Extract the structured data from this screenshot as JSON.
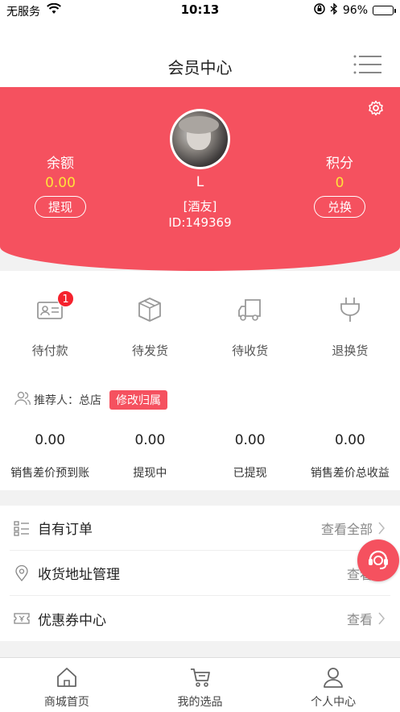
{
  "status_bar": {
    "carrier": "无服务",
    "time": "10:13",
    "battery": "96%"
  },
  "nav": {
    "title": "会员中心"
  },
  "profile": {
    "balance_label": "余额",
    "balance_value": "0.00",
    "withdraw_label": "提现",
    "points_label": "积分",
    "points_value": "0",
    "exchange_label": "兑换",
    "name": "L",
    "level": "[酒友]",
    "id": "ID:149369"
  },
  "orders": [
    {
      "label": "待付款",
      "badge": "1"
    },
    {
      "label": "待发货"
    },
    {
      "label": "待收货"
    },
    {
      "label": "退换货"
    }
  ],
  "referrer": {
    "label": "推荐人：总店",
    "button": "修改归属"
  },
  "stats": [
    {
      "value": "0.00",
      "caption": "销售差价预到账"
    },
    {
      "value": "0.00",
      "caption": "提现中"
    },
    {
      "value": "0.00",
      "caption": "已提现"
    },
    {
      "value": "0.00",
      "caption": "销售差价总收益"
    }
  ],
  "menu": [
    {
      "label": "自有订单",
      "more": "查看全部"
    },
    {
      "label": "收货地址管理",
      "more": "查看"
    },
    {
      "label": "优惠券中心",
      "more": "查看"
    }
  ],
  "tabs": [
    {
      "label": "商城首页"
    },
    {
      "label": "我的选品"
    },
    {
      "label": "个人中心"
    }
  ],
  "colors": {
    "accent": "#f5515f",
    "value_yellow": "#ffe23a"
  }
}
